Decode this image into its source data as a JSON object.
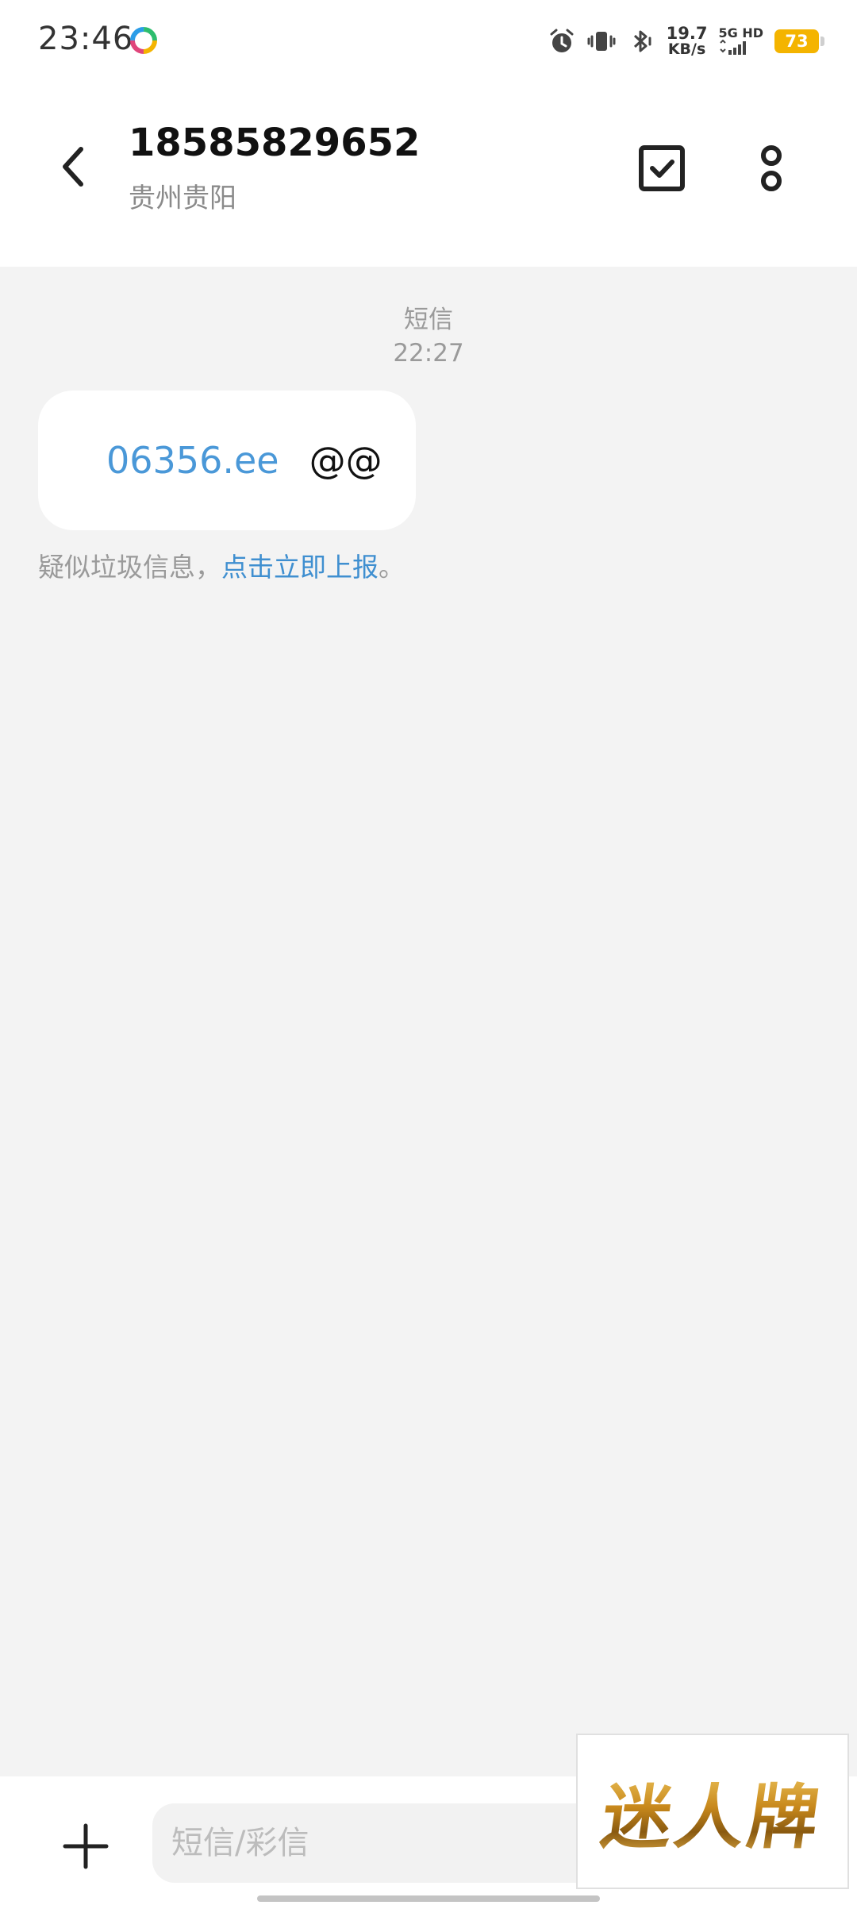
{
  "status_bar": {
    "time": "23:46",
    "net_speed_value": "19.7",
    "net_speed_unit": "KB/s",
    "signal_label": "5G HD",
    "battery": "73",
    "battery_color": "#f4b400"
  },
  "header": {
    "contact_number": "18585829652",
    "contact_location": "贵州贵阳"
  },
  "conversation": {
    "message_type": "短信",
    "message_time": "22:27",
    "message_link": "06356.ee",
    "message_text": "@@",
    "spam_notice_prefix": "疑似垃圾信息，",
    "spam_notice_link": "点击立即上报",
    "spam_notice_suffix": "。"
  },
  "input_bar": {
    "placeholder": "短信/彩信"
  },
  "watermark": {
    "text": "迷人牌"
  },
  "colors": {
    "link": "#4a98d8",
    "background": "#f3f3f3"
  }
}
